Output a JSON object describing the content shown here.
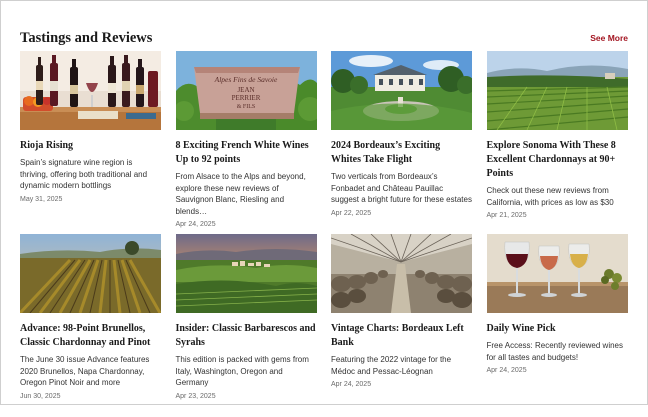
{
  "section": {
    "title": "Tastings and Reviews",
    "see_more": "See More"
  },
  "cards": [
    {
      "title": "Rioja Rising",
      "description": "Spain’s signature wine region is thriving, offering both traditional and dynamic modern bottlings",
      "date": "May 31, 2025",
      "image_icon": "wine-bottles-table-image"
    },
    {
      "title": "8 Exciting French White Wines Up to 92 points",
      "description": "From Alsace to the Alps and beyond, explore these new reviews of Sauvignon Blanc, Riesling and blends…",
      "date": "Apr 24, 2025",
      "image_icon": "winery-sign-image",
      "sign_text": [
        "Alpes Fins de Savoie",
        "JEAN",
        "PERRIER",
        "& FILS"
      ]
    },
    {
      "title": "2024 Bordeaux’s Exciting Whites Take Flight",
      "description": "Two verticals from Bordeaux’s Fonbadet and Château Pauillac suggest a bright future for these estates",
      "date": "Apr 22, 2025",
      "image_icon": "chateau-garden-image"
    },
    {
      "title": "Explore Sonoma With These 8 Excellent Chardonnays at 90+ Points",
      "description": "Check out these new reviews from California, with prices as low as $30",
      "date": "Apr 21, 2025",
      "image_icon": "vineyard-hills-image"
    },
    {
      "title": "Advance: 98-Point Brunellos, Classic Chardonnay and Pinot",
      "description": "The June 30 issue Advance features 2020 Brunellos, Napa Chardonnay, Oregon Pinot Noir and more",
      "date": "Jun 30, 2025",
      "image_icon": "vineyard-sunset-image"
    },
    {
      "title": "Insider: Classic Barbarescos and Syrahs",
      "description": "This edition is packed with gems from Italy, Washington, Oregon and Germany",
      "date": "Apr 23, 2025",
      "image_icon": "village-vineyards-image"
    },
    {
      "title": "Vintage Charts: Bordeaux Left Bank",
      "description": "Featuring the 2022 vintage for the Médoc and Pessac-Léognan",
      "date": "Apr 24, 2025",
      "image_icon": "barrel-cellar-image"
    },
    {
      "title": "Daily Wine Pick",
      "description": "Free Access: Recently reviewed wines for all tastes and budgets!",
      "date": "Apr 24, 2025",
      "image_icon": "wine-glasses-image"
    }
  ]
}
